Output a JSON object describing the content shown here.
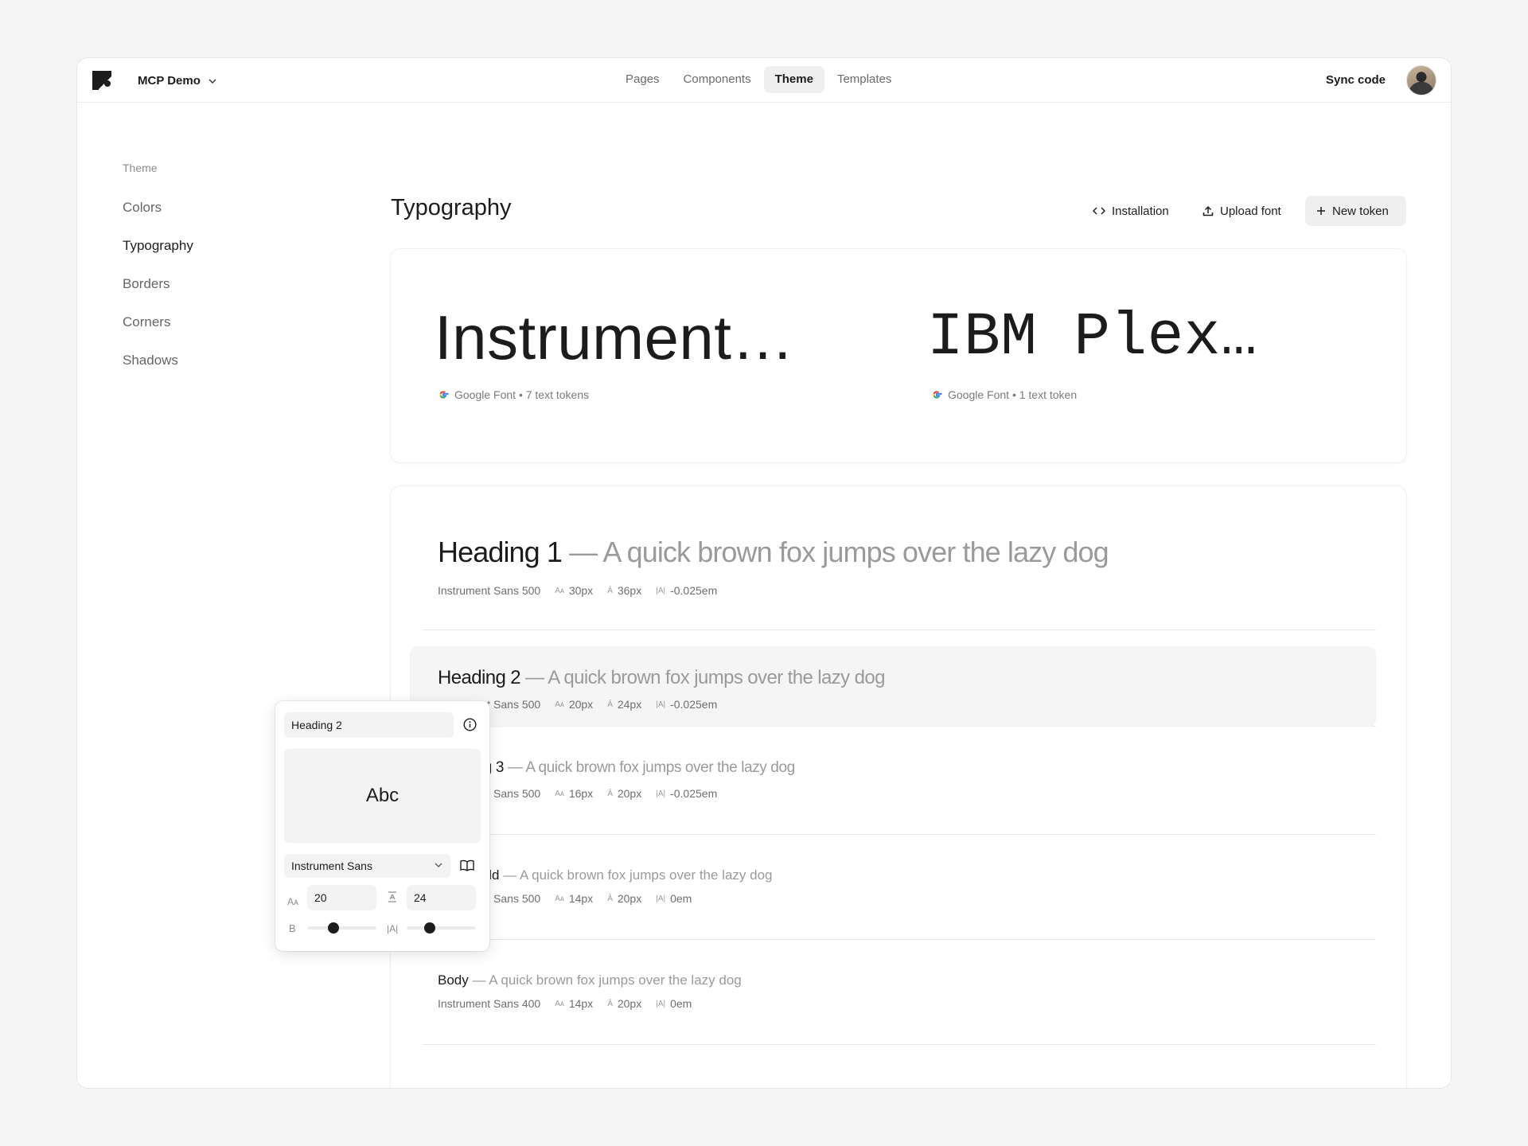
{
  "topbar": {
    "project_name": "MCP Demo",
    "tabs": [
      {
        "label": "Pages"
      },
      {
        "label": "Components"
      },
      {
        "label": "Theme"
      },
      {
        "label": "Templates"
      }
    ],
    "active_tab": "Theme",
    "sync_label": "Sync code"
  },
  "sidebar": {
    "section": "Theme",
    "items": [
      {
        "label": "Colors"
      },
      {
        "label": "Typography"
      },
      {
        "label": "Borders"
      },
      {
        "label": "Corners"
      },
      {
        "label": "Shadows"
      }
    ],
    "active_item": "Typography"
  },
  "main": {
    "title": "Typography",
    "actions": {
      "installation": "Installation",
      "upload_font": "Upload font",
      "new_token": "New token"
    },
    "fonts": [
      {
        "name": "Instrument…",
        "meta": "Google Font • 7 text tokens"
      },
      {
        "name": "IBM Plex…",
        "meta": "Google Font • 1 text token"
      }
    ],
    "tokens": [
      {
        "name": "Heading 1",
        "sample": " — A quick brown fox jumps over the lazy dog",
        "font": "Instrument Sans 500",
        "size": "30px",
        "line_height": "36px",
        "tracking": "-0.025em"
      },
      {
        "name": "Heading 2",
        "sample": " — A quick brown fox jumps over the lazy dog",
        "font": "Instrument Sans 500",
        "size": "20px",
        "line_height": "24px",
        "tracking": "-0.025em"
      },
      {
        "name": "Heading 3",
        "sample": " — A quick brown fox jumps over the lazy dog",
        "font": "Instrument Sans 500",
        "size": "16px",
        "line_height": "20px",
        "tracking": "-0.025em"
      },
      {
        "name": "Body Bold",
        "sample": " — A quick brown fox jumps over the lazy dog",
        "font": "Instrument Sans 500",
        "size": "14px",
        "line_height": "20px",
        "tracking": "0em"
      },
      {
        "name": "Body",
        "sample": " — A quick brown fox jumps over the lazy dog",
        "font": "Instrument Sans 400",
        "size": "14px",
        "line_height": "20px",
        "tracking": "0em"
      }
    ],
    "icon_glyphs": {
      "size": "Aᴀ",
      "line_height": "Ā",
      "tracking": "|A|"
    }
  },
  "editor": {
    "token_name": "Heading 2",
    "preview": "Abc",
    "font_family": "Instrument Sans",
    "size_label": "Aᴀ",
    "size_value": "20",
    "line_height_value": "24",
    "weight_label": "B",
    "tracking_label": "|A|",
    "weight_fraction": 0.36,
    "tracking_fraction": 0.3
  },
  "help_label": "?",
  "colors": {
    "accent": "#1c1c1c",
    "muted": "#9a9a9a",
    "surface": "#f3f3f3"
  }
}
